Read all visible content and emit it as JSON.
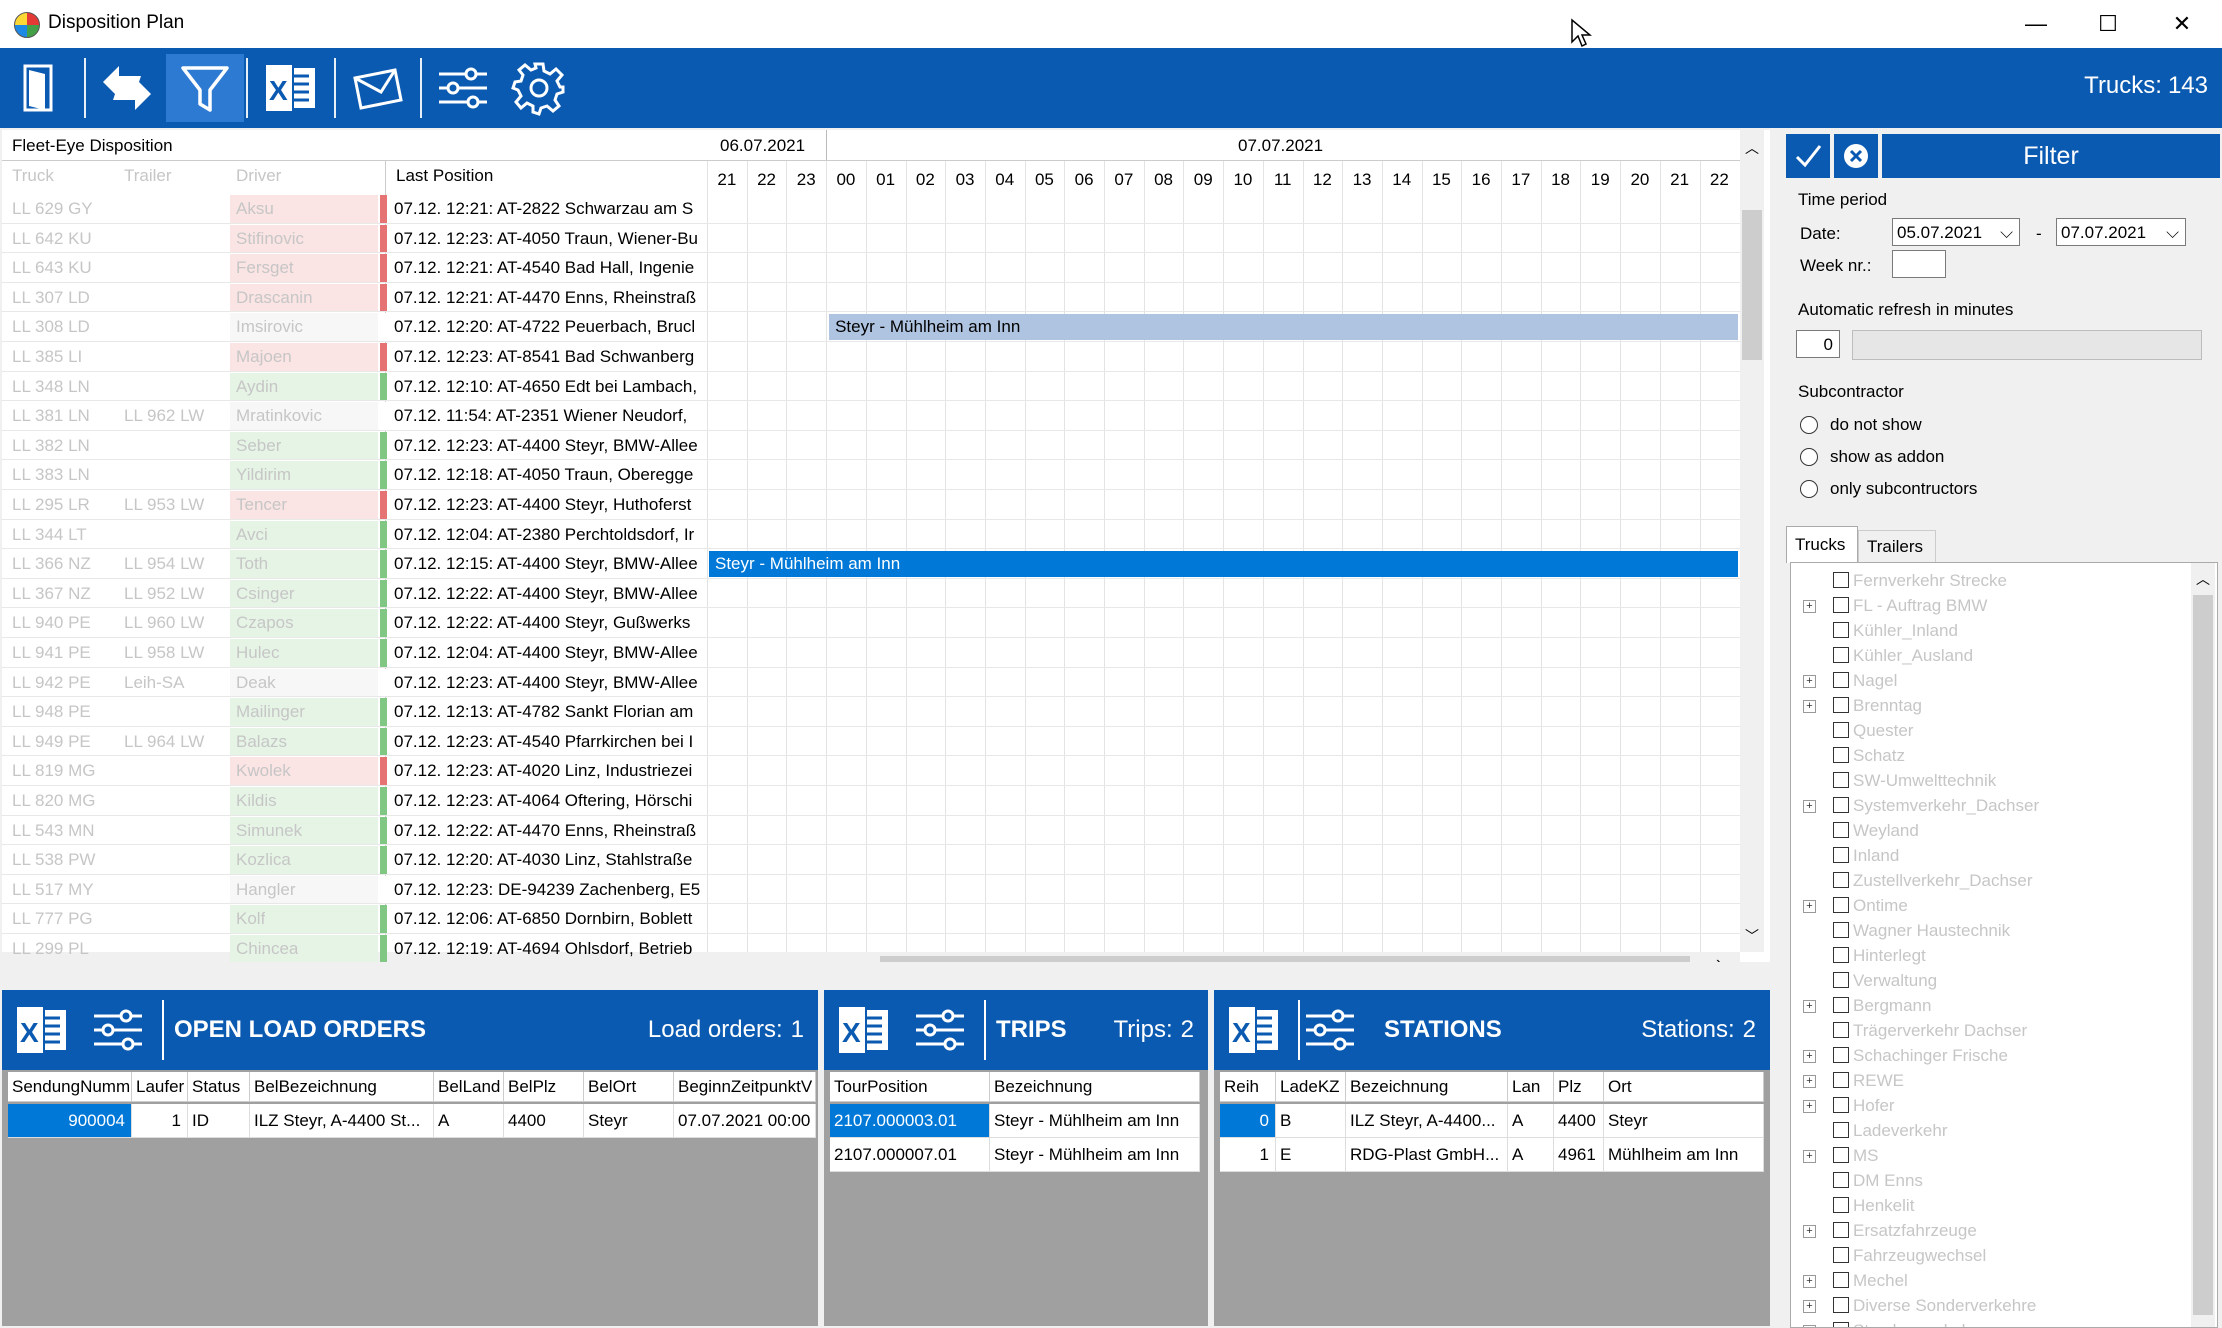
{
  "window": {
    "title": "Disposition Plan",
    "minimize": "—",
    "maximize": "☐",
    "close": "✕"
  },
  "toolbar": {
    "trucks_label": "Trucks:",
    "trucks_count": "143"
  },
  "grid": {
    "title": "Fleet-Eye Disposition",
    "columns": {
      "truck": "Truck",
      "trailer": "Trailer",
      "driver": "Driver",
      "last_position": "Last Position"
    },
    "dates": [
      "06.07.2021",
      "07.07.2021"
    ],
    "hours": [
      "21",
      "22",
      "23",
      "00",
      "01",
      "02",
      "03",
      "04",
      "05",
      "06",
      "07",
      "08",
      "09",
      "10",
      "11",
      "12",
      "13",
      "14",
      "15",
      "16",
      "17",
      "18",
      "19",
      "20",
      "21",
      "22"
    ],
    "rows": [
      {
        "truck": "LL 629 GY",
        "trailer": "",
        "driver": "Aksu",
        "status": "#e57373",
        "pos": "07.12. 12:21: AT-2822 Schwarzau am S"
      },
      {
        "truck": "LL 642 KU",
        "trailer": "",
        "driver": "Stifinovic",
        "status": "#e57373",
        "pos": "07.12. 12:23: AT-4050 Traun, Wiener-Bu"
      },
      {
        "truck": "LL 643 KU",
        "trailer": "",
        "driver": "Fersget",
        "status": "#e57373",
        "pos": "07.12. 12:21: AT-4540 Bad Hall, Ingenie"
      },
      {
        "truck": "LL 307 LD",
        "trailer": "",
        "driver": "Drascanin",
        "status": "#e57373",
        "pos": "07.12. 12:21: AT-4470 Enns, Rheinstraß"
      },
      {
        "truck": "LL 308 LD",
        "trailer": "",
        "driver": "Imsirovic",
        "status": "#ffffff",
        "pos": "07.12. 12:20: AT-4722 Peuerbach, Brucl"
      },
      {
        "truck": "LL 385 LI",
        "trailer": "",
        "driver": "Majoen",
        "status": "#e57373",
        "pos": "07.12. 12:23: AT-8541 Bad Schwanberg"
      },
      {
        "truck": "LL 348 LN",
        "trailer": "",
        "driver": "Aydin",
        "status": "#81c784",
        "pos": "07.12. 12:10: AT-4650 Edt bei Lambach,"
      },
      {
        "truck": "LL 381 LN",
        "trailer": "LL 962 LW",
        "driver": "Mratinkovic",
        "status": "#ffffff",
        "pos": "07.12. 11:54: AT-2351 Wiener Neudorf,"
      },
      {
        "truck": "LL 382 LN",
        "trailer": "",
        "driver": "Seber",
        "status": "#81c784",
        "pos": "07.12. 12:23: AT-4400 Steyr, BMW-Allee"
      },
      {
        "truck": "LL 383 LN",
        "trailer": "",
        "driver": "Yildirim",
        "status": "#81c784",
        "pos": "07.12. 12:18: AT-4050 Traun, Oberegge"
      },
      {
        "truck": "LL 295 LR",
        "trailer": "LL 953 LW",
        "driver": "Tencer",
        "status": "#e57373",
        "pos": "07.12. 12:23: AT-4400 Steyr, Huthoferst"
      },
      {
        "truck": "LL 344 LT",
        "trailer": "",
        "driver": "Avci",
        "status": "#81c784",
        "pos": "07.12. 12:04: AT-2380 Perchtoldsdorf, Ir"
      },
      {
        "truck": "LL 366 NZ",
        "trailer": "LL 954 LW",
        "driver": "Toth",
        "status": "#81c784",
        "pos": "07.12. 12:15: AT-4400 Steyr, BMW-Allee"
      },
      {
        "truck": "LL 367 NZ",
        "trailer": "LL 952 LW",
        "driver": "Csinger",
        "status": "#81c784",
        "pos": "07.12. 12:22: AT-4400 Steyr, BMW-Allee"
      },
      {
        "truck": "LL 940 PE",
        "trailer": "LL 960 LW",
        "driver": "Czapos",
        "status": "#81c784",
        "pos": "07.12. 12:22: AT-4400 Steyr, Gußwerks"
      },
      {
        "truck": "LL 941 PE",
        "trailer": "LL 958 LW",
        "driver": "Hulec",
        "status": "#81c784",
        "pos": "07.12. 12:04: AT-4400 Steyr, BMW-Allee"
      },
      {
        "truck": "LL 942 PE",
        "trailer": "Leih-SA",
        "driver": "Deak",
        "status": "#ffffff",
        "pos": "07.12. 12:23: AT-4400 Steyr, BMW-Allee"
      },
      {
        "truck": "LL 948 PE",
        "trailer": "",
        "driver": "Mailinger",
        "status": "#81c784",
        "pos": "07.12. 12:13: AT-4782 Sankt Florian am"
      },
      {
        "truck": "LL 949 PE",
        "trailer": "LL 964 LW",
        "driver": "Balazs",
        "status": "#81c784",
        "pos": "07.12. 12:23: AT-4540 Pfarrkirchen bei I"
      },
      {
        "truck": "LL 819 MG",
        "trailer": "",
        "driver": "Kwolek",
        "status": "#e57373",
        "pos": "07.12. 12:23: AT-4020 Linz, Industriezei"
      },
      {
        "truck": "LL 820 MG",
        "trailer": "",
        "driver": "Kildis",
        "status": "#81c784",
        "pos": "07.12. 12:23: AT-4064 Oftering, Hörschi"
      },
      {
        "truck": "LL 543 MN",
        "trailer": "",
        "driver": "Simunek",
        "status": "#81c784",
        "pos": "07.12. 12:22: AT-4470 Enns, Rheinstraß"
      },
      {
        "truck": "LL 538 PW",
        "trailer": "",
        "driver": "Kozlica",
        "status": "#81c784",
        "pos": "07.12. 12:20: AT-4030 Linz, Stahlstraße"
      },
      {
        "truck": "LL 517 MY",
        "trailer": "",
        "driver": "Hangler",
        "status": "#ffffff",
        "pos": "07.12. 12:23: DE-94239 Zachenberg, E5"
      },
      {
        "truck": "LL 777 PG",
        "trailer": "",
        "driver": "Kolf",
        "status": "#81c784",
        "pos": "07.12. 12:06: AT-6850 Dornbirn, Boblett"
      },
      {
        "truck": "LL 299 PL",
        "trailer": "",
        "driver": "Chincea",
        "status": "#81c784",
        "pos": "07.12. 12:19: AT-4694 Ohlsdorf, Betrieb"
      }
    ],
    "bars": [
      {
        "row": 4,
        "label": "Steyr - Mühlheim am Inn",
        "color": "#aec4e0",
        "text": "#000000"
      },
      {
        "row": 12,
        "label": "Steyr - Mühlheim am Inn",
        "color": "#0078d7",
        "text": "#ffffff"
      }
    ]
  },
  "filter": {
    "title": "Filter",
    "time_period": "Time period",
    "date_label": "Date:",
    "date_from": "05.07.2021",
    "date_sep": "-",
    "date_to": "07.07.2021",
    "week_label": "Week nr.:",
    "week_value": "",
    "refresh_label": "Automatic refresh in minutes",
    "refresh_value": "0",
    "subcontractor_label": "Subcontractor",
    "radios": [
      "do not show",
      "show as addon",
      "only subcontructors"
    ],
    "tabs": [
      "Trucks",
      "Trailers"
    ],
    "tree": [
      {
        "label": "Fernverkehr Strecke",
        "plus": false
      },
      {
        "label": "FL - Auftrag BMW",
        "plus": true
      },
      {
        "label": "Kühler_Inland",
        "plus": false
      },
      {
        "label": "Kühler_Ausland",
        "plus": false
      },
      {
        "label": "Nagel",
        "plus": true
      },
      {
        "label": "Brenntag",
        "plus": true
      },
      {
        "label": "Quester",
        "plus": false
      },
      {
        "label": "Schatz",
        "plus": false
      },
      {
        "label": "SW-Umwelttechnik",
        "plus": false
      },
      {
        "label": "Systemverkehr_Dachser",
        "plus": true
      },
      {
        "label": "Weyland",
        "plus": false
      },
      {
        "label": "Inland",
        "plus": false
      },
      {
        "label": "Zustellverkehr_Dachser",
        "plus": false
      },
      {
        "label": "Ontime",
        "plus": true
      },
      {
        "label": "Wagner Haustechnik",
        "plus": false
      },
      {
        "label": "Hinterlegt",
        "plus": false
      },
      {
        "label": "Verwaltung",
        "plus": false
      },
      {
        "label": "Bergmann",
        "plus": true
      },
      {
        "label": "Trägerverkehr Dachser",
        "plus": false
      },
      {
        "label": "Schachinger Frische",
        "plus": true
      },
      {
        "label": "REWE",
        "plus": true
      },
      {
        "label": "Hofer",
        "plus": true
      },
      {
        "label": "Ladeverkehr",
        "plus": false
      },
      {
        "label": "MS",
        "plus": true
      },
      {
        "label": "DM Enns",
        "plus": false
      },
      {
        "label": "Henkelit",
        "plus": false
      },
      {
        "label": "Ersatzfahrzeuge",
        "plus": true
      },
      {
        "label": "Fahrzeugwechsel",
        "plus": false
      },
      {
        "label": "Mechel",
        "plus": true
      },
      {
        "label": "Diverse Sonderverkehre",
        "plus": true
      },
      {
        "label": "Streckenverkehr",
        "plus": true
      }
    ]
  },
  "orders": {
    "title": "OPEN LOAD ORDERS",
    "count_label": "Load orders:",
    "count": "1",
    "headers": [
      "SendungNumm",
      "Laufer",
      "Status",
      "BelBezeichnung",
      "BelLand",
      "BelPlz",
      "BelOrt",
      "BeginnZeitpunktV"
    ],
    "rows": [
      [
        "900004",
        "1",
        "ID",
        "ILZ Steyr, A-4400 St...",
        "A",
        "4400",
        "Steyr",
        "07.07.2021 00:00"
      ]
    ]
  },
  "trips": {
    "title": "TRIPS",
    "count_label": "Trips:",
    "count": "2",
    "headers": [
      "TourPosition",
      "Bezeichnung"
    ],
    "rows": [
      [
        "2107.000003.01",
        "Steyr - Mühlheim am Inn"
      ],
      [
        "2107.000007.01",
        "Steyr - Mühlheim am Inn"
      ]
    ]
  },
  "stations": {
    "title": "STATIONS",
    "count_label": "Stations:",
    "count": "2",
    "headers": [
      "Reih",
      "LadeKZ",
      "Bezeichnung",
      "Lan",
      "Plz",
      "Ort"
    ],
    "rows": [
      [
        "0",
        "B",
        "ILZ Steyr, A-4400...",
        "A",
        "4400",
        "Steyr"
      ],
      [
        "1",
        "E",
        "RDG-Plast GmbH...",
        "A",
        "4961",
        "Mühlheim am Inn"
      ]
    ]
  },
  "icons": [
    "exit-door-icon",
    "refresh-arrows-icon",
    "filter-funnel-icon",
    "excel-icon",
    "mail-envelope-icon",
    "sliders-icon",
    "gear-icon"
  ]
}
